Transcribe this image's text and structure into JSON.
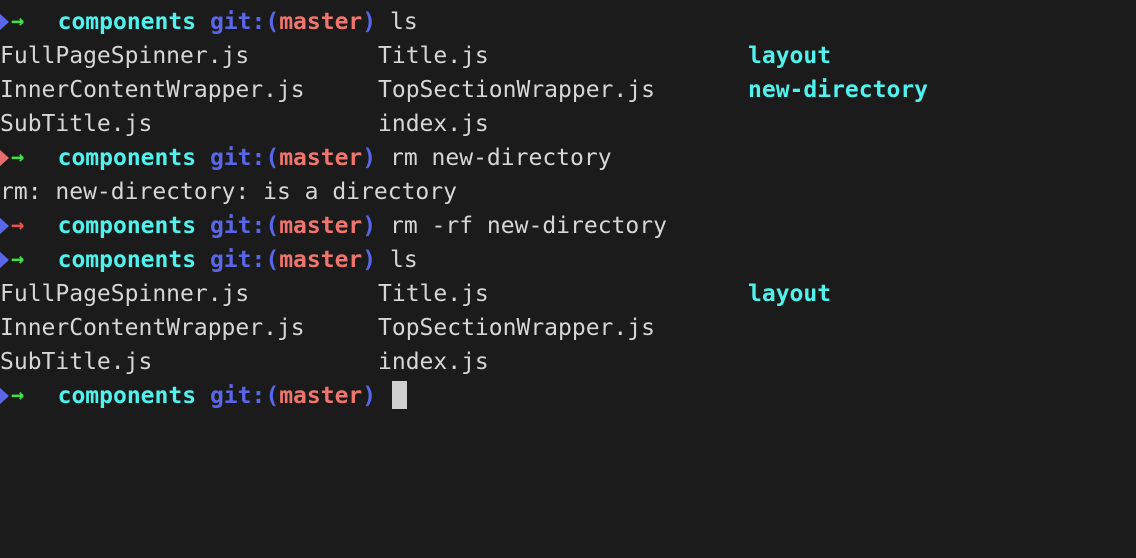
{
  "terminal": {
    "window_title": "components",
    "shell": "zsh",
    "colors": {
      "background": "#1b1b1b",
      "foreground": "#d6d6d6",
      "directory_cyan": "#4ff2ec",
      "git_blue": "#5a66e8",
      "branch_red": "#f0756e",
      "arrow_green": "#3fe04a",
      "arrow_red": "#e8564e",
      "triangle_blue": "#5a66e8",
      "triangle_red": "#e86c6c",
      "cursor": "#d0d0d0"
    },
    "prompt": {
      "triangle_icon": "arrow-right-triangle-icon",
      "arrow_icon": "arrow-right-icon",
      "cwd": "components",
      "git_label": "git:",
      "paren_open": "(",
      "branch": "master",
      "paren_close": ")"
    },
    "lines": [
      {
        "type": "prompt",
        "triangle_color": "blue",
        "arrow_color": "green",
        "command": "ls"
      },
      {
        "type": "output-row",
        "cells": [
          {
            "text": "FullPageSpinner.js",
            "kind": "file"
          },
          {
            "text": "Title.js",
            "kind": "file"
          },
          {
            "text": "layout",
            "kind": "dir"
          }
        ]
      },
      {
        "type": "output-row",
        "cells": [
          {
            "text": "InnerContentWrapper.js",
            "kind": "file"
          },
          {
            "text": "TopSectionWrapper.js",
            "kind": "file"
          },
          {
            "text": "new-directory",
            "kind": "dir"
          }
        ]
      },
      {
        "type": "output-row",
        "cells": [
          {
            "text": "SubTitle.js",
            "kind": "file"
          },
          {
            "text": "index.js",
            "kind": "file"
          },
          {
            "text": "",
            "kind": "file"
          }
        ]
      },
      {
        "type": "prompt",
        "triangle_color": "red",
        "arrow_color": "green",
        "command": "rm new-directory"
      },
      {
        "type": "output",
        "text": "rm: new-directory: is a directory"
      },
      {
        "type": "prompt",
        "triangle_color": "blue",
        "arrow_color": "red",
        "command": "rm -rf new-directory"
      },
      {
        "type": "prompt",
        "triangle_color": "blue",
        "arrow_color": "green",
        "command": "ls"
      },
      {
        "type": "output-row",
        "cells": [
          {
            "text": "FullPageSpinner.js",
            "kind": "file"
          },
          {
            "text": "Title.js",
            "kind": "file"
          },
          {
            "text": "layout",
            "kind": "dir"
          }
        ]
      },
      {
        "type": "output-row",
        "cells": [
          {
            "text": "InnerContentWrapper.js",
            "kind": "file"
          },
          {
            "text": "TopSectionWrapper.js",
            "kind": "file"
          },
          {
            "text": "",
            "kind": "file"
          }
        ]
      },
      {
        "type": "output-row",
        "cells": [
          {
            "text": "SubTitle.js",
            "kind": "file"
          },
          {
            "text": "index.js",
            "kind": "file"
          },
          {
            "text": "",
            "kind": "file"
          }
        ]
      },
      {
        "type": "prompt",
        "triangle_color": "blue",
        "arrow_color": "green",
        "command": "",
        "cursor": true
      }
    ]
  },
  "glyphs": {
    "arrow_right": "→"
  }
}
